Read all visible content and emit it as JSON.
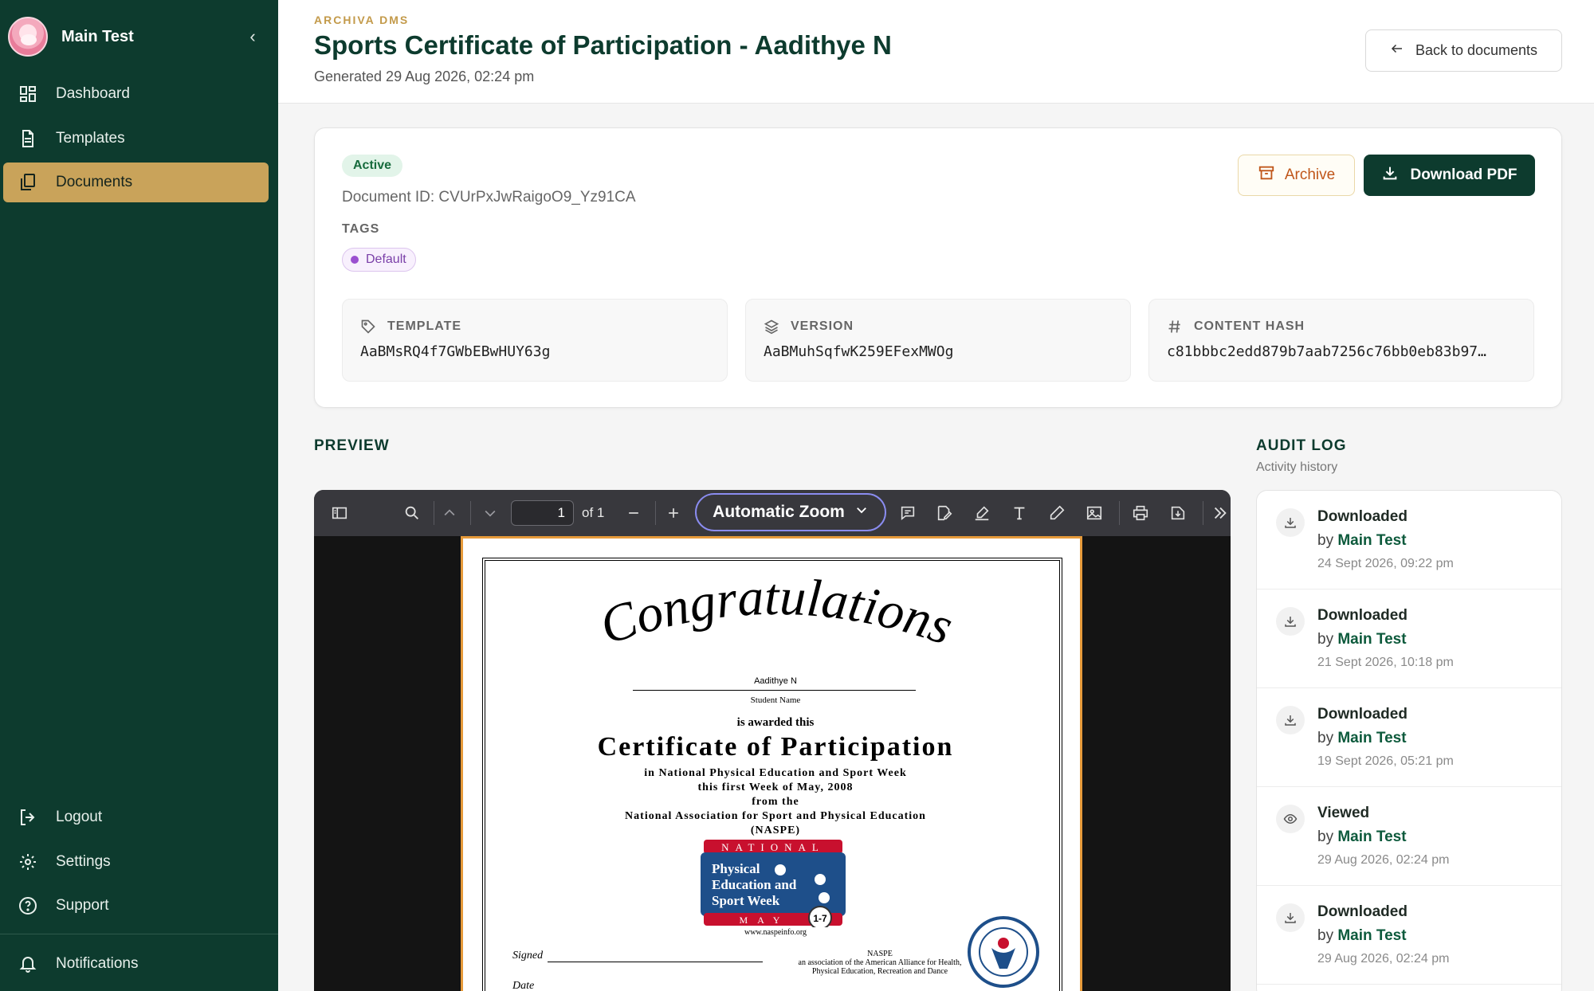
{
  "sidebar": {
    "user_name": "Main Test",
    "collapse_glyph": "‹",
    "nav": [
      {
        "label": "Dashboard",
        "icon": "dashboard-icon"
      },
      {
        "label": "Templates",
        "icon": "file-text-icon"
      },
      {
        "label": "Documents",
        "icon": "files-icon",
        "active": true
      }
    ],
    "bottom": [
      {
        "label": "Logout",
        "icon": "logout-icon"
      },
      {
        "label": "Settings",
        "icon": "gear-icon"
      },
      {
        "label": "Support",
        "icon": "help-circle-icon"
      },
      {
        "label": "Notifications",
        "icon": "bell-icon"
      }
    ]
  },
  "header": {
    "brand": "ARCHIVA DMS",
    "title": "Sports Certificate of Participation - Aadithye N",
    "subtitle": "Generated 29 Aug 2026, 02:24 pm",
    "back_label": "Back to documents"
  },
  "document": {
    "status": "Active",
    "id_text": "Document ID: CVUrPxJwRaigoO9_Yz91CA",
    "tags_label": "TAGS",
    "tags": [
      "Default"
    ],
    "archive_label": "Archive",
    "download_label": "Download PDF",
    "meta": [
      {
        "label": "TEMPLATE",
        "value": "AaBMsRQ4f7GWbEBwHUY63g",
        "icon": "tag-icon"
      },
      {
        "label": "VERSION",
        "value": "AaBMuhSqfwK259EFexMWOg",
        "icon": "layers-icon"
      },
      {
        "label": "CONTENT HASH",
        "value": "c81bbbc2edd879b7aab7256c76bb0eb83b97…",
        "icon": "hash-icon"
      }
    ]
  },
  "preview": {
    "title": "PREVIEW",
    "page_number": "1",
    "page_of": "of 1",
    "zoom": "Automatic Zoom",
    "certificate": {
      "heading": "Congratulations",
      "name": "Aadithye N",
      "name_caption": "Student Name",
      "awarded": "is awarded this",
      "title": "Certificate of Participation",
      "lines": [
        "in National Physical Education and Sport Week",
        "this first Week of May, 2008",
        "from the",
        "National Association for Sport and Physical Education",
        "(NASPE)"
      ],
      "badge_top": "NATIONAL",
      "badge_lines": [
        "Physical",
        "Education and",
        "Sport Week"
      ],
      "badge_bottom": "MAY",
      "badge_dates": "1-7",
      "url": "www.naspeinfo.org",
      "signed_label": "Signed",
      "date_label": "Date",
      "naspe_lines": [
        "NASPE",
        "an association of the American Alliance for Health,",
        "Physical Education, Recreation and Dance"
      ]
    }
  },
  "audit": {
    "title": "AUDIT LOG",
    "subtitle": "Activity history",
    "by_prefix": "by",
    "entries": [
      {
        "action": "Downloaded",
        "user": "Main Test",
        "time": "24 Sept 2026, 09:22 pm",
        "icon": "download-icon"
      },
      {
        "action": "Downloaded",
        "user": "Main Test",
        "time": "21 Sept 2026, 10:18 pm",
        "icon": "download-icon"
      },
      {
        "action": "Downloaded",
        "user": "Main Test",
        "time": "19 Sept 2026, 05:21 pm",
        "icon": "download-icon"
      },
      {
        "action": "Viewed",
        "user": "Main Test",
        "time": "29 Aug 2026, 02:24 pm",
        "icon": "eye-icon"
      },
      {
        "action": "Downloaded",
        "user": "Main Test",
        "time": "29 Aug 2026, 02:24 pm",
        "icon": "download-icon"
      }
    ]
  },
  "colors": {
    "sidebar_bg": "#0d3b2e",
    "active_nav": "#c9a35a",
    "primary": "#0d3b2e",
    "brand_gold": "#c39a4a"
  }
}
